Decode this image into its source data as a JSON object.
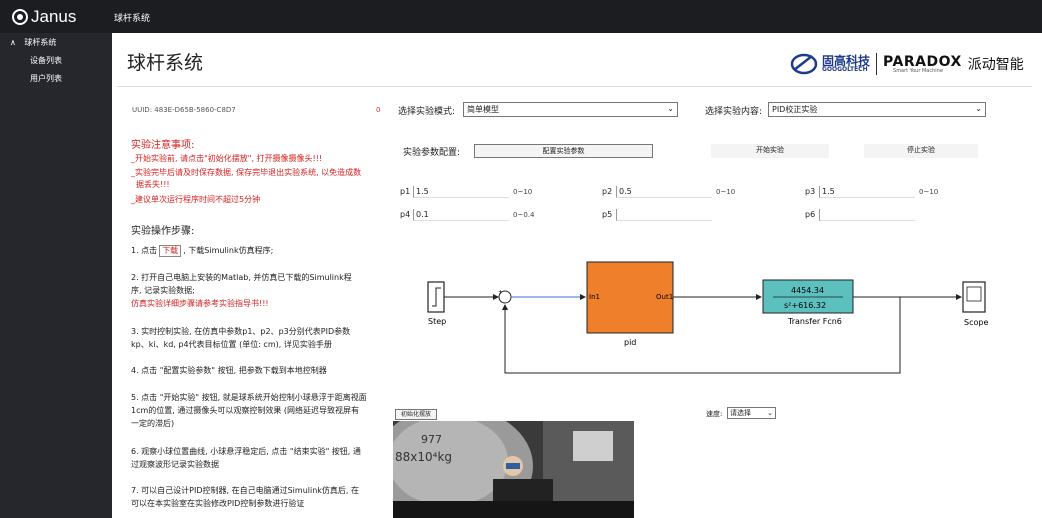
{
  "app": {
    "logo": "Janus",
    "nav_title": "球杆系统"
  },
  "sidebar": {
    "active": "球杆系统",
    "items": [
      "设备列表",
      "用户列表"
    ]
  },
  "page": {
    "title": "球杆系统"
  },
  "brand": {
    "gg_cn": "固高科技",
    "gg_en": "GOOGOLTECH",
    "paradox": "PARADOX",
    "paradox_sub": "Smart Your Machine",
    "paradox_cn": "派动智能"
  },
  "uuid": {
    "label": "UUID: 483E-D65B-5860-C8D7",
    "status": "0"
  },
  "notes": {
    "title": "实验注意事项:",
    "lines": [
      "_开始实验前, 请点击\"初始化摆放\", 打开摄像摄像头!!!",
      "_实验完毕后请及时保存数据, 保存完毕退出实验系统, 以免造成数",
      "据丢失!!!",
      "_建议单次运行程序时间不超过5分钟"
    ]
  },
  "steps": {
    "title": "实验操作步骤:",
    "s1_pre": "1. 点击",
    "s1_btn": "下载",
    "s1_post": ", 下载Simulink仿真程序;",
    "s2": [
      "2. 打开自己电脑上安装的Matlab, 并仿真已下载的Simulink程",
      "序, 记录实验数据;"
    ],
    "s2_red": "仿真实验详细步骤请参考实验指导书!!!",
    "s3": [
      "3. 实时控制实验, 在仿真中参数p1、p2、p3分别代表PID参数",
      "kp、ki、kd, p4代表目标位置 (单位: cm), 详见实验手册"
    ],
    "s4": "4. 点击 \"配置实验参数\" 按钮, 把参数下载到本地控制器",
    "s5": [
      "5. 点击 \"开始实验\" 按钮, 就是球系统开始控制小球悬浮于距离视面",
      "1cm的位置, 通过摄像头可以观察控制效果 (网络延迟导致视屏有",
      "一定的滞后)"
    ],
    "s6": [
      "6. 观察小球位置曲线, 小球悬浮稳定后, 点击 \"结束实验\" 按钮, 通",
      "过观察波形记录实验数据"
    ],
    "s7": [
      "7. 可以自己设计PID控制器, 在自己电脑通过Simulink仿真后, 在",
      "可以在本实验室在实验修改PID控制参数进行验证"
    ]
  },
  "controls": {
    "mode_label": "选择实验模式:",
    "mode_value": "简单模型",
    "content_label": "选择实验内容:",
    "content_value": "PID校正实验",
    "config_label": "实验参数配置:",
    "config_btn": "配置实验参数",
    "start_btn": "开始实验",
    "stop_btn": "停止实验"
  },
  "params": [
    {
      "label": "p1",
      "value": "1.5",
      "range": "0~10"
    },
    {
      "label": "p2",
      "value": "0.5",
      "range": "0~10"
    },
    {
      "label": "p3",
      "value": "1.5",
      "range": "0~10"
    },
    {
      "label": "p4",
      "value": "0.1",
      "range": "0~0.4"
    },
    {
      "label": "p5",
      "value": "",
      "range": ""
    },
    {
      "label": "p6",
      "value": "",
      "range": ""
    }
  ],
  "diagram": {
    "step": "Step",
    "pid_in": "In1",
    "pid_out": "Out1",
    "pid": "pid",
    "tf_num": "4454.34",
    "tf_den": "s²+616.32",
    "tf": "Transfer Fcn6",
    "scope": "Scope"
  },
  "video": {
    "init_btn": "初始化摆放",
    "speed_label": "速度:",
    "speed_value": "请选择",
    "overlay1": "977",
    "overlay2": "88x10⁴kg"
  },
  "colors": {
    "topbar": "#1c1d21",
    "sidebar": "#26272d",
    "red_text": "#d62020",
    "pid_block": "#ef7f2a",
    "tf_block": "#5bc0be"
  }
}
